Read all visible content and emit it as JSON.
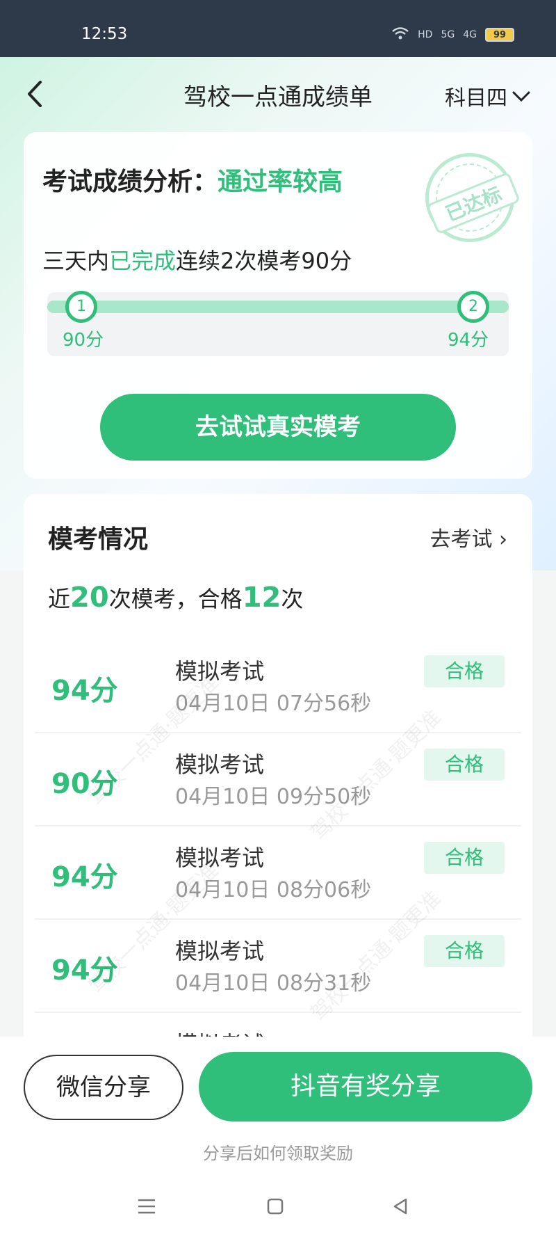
{
  "status": {
    "time": "12:53",
    "net1": "HD",
    "net2": "5G",
    "net3": "4G",
    "battery": "99"
  },
  "nav": {
    "title": "驾校一点通成绩单",
    "subject": "科目四"
  },
  "analysis": {
    "title_prefix": "考试成绩分析：",
    "title_highlight": "通过率较高",
    "stamp": "已达标",
    "streak_a": "三天内",
    "streak_b": "已完成",
    "streak_c": "连续2次模考90分",
    "nodes": [
      {
        "index": "1",
        "score": "90分"
      },
      {
        "index": "2",
        "score": "94分"
      }
    ],
    "try_button": "去试试真实模考"
  },
  "mock": {
    "title": "模考情况",
    "go_exam": "去考试 ›",
    "summary_a": "近",
    "summary_count": "20",
    "summary_b": "次模考，合格",
    "summary_pass": "12",
    "summary_c": "次",
    "rows": [
      {
        "score": "94分",
        "name": "模拟考试",
        "time": "04月10日 07分56秒",
        "badge": "合格"
      },
      {
        "score": "90分",
        "name": "模拟考试",
        "time": "04月10日 09分50秒",
        "badge": "合格"
      },
      {
        "score": "94分",
        "name": "模拟考试",
        "time": "04月10日 08分06秒",
        "badge": "合格"
      },
      {
        "score": "94分",
        "name": "模拟考试",
        "time": "04月10日 08分31秒",
        "badge": "合格"
      },
      {
        "score": "",
        "name": "模拟考试",
        "time": "",
        "badge": ""
      }
    ],
    "watermark": "驾校一点通·题更准"
  },
  "bottom": {
    "wechat_share": "微信分享",
    "douyin_share": "抖音有奖分享",
    "hint": "分享后如何领取奖励"
  }
}
